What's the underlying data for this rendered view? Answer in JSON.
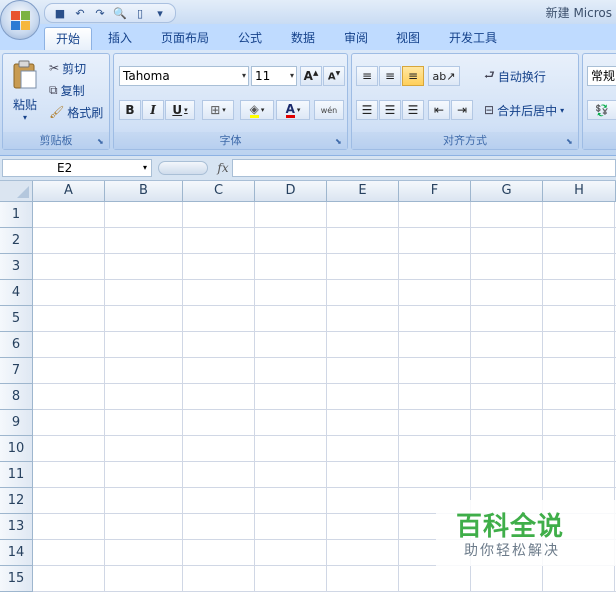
{
  "window": {
    "title": "新建 Micros"
  },
  "quick_access": [
    {
      "icon": "save-icon",
      "glyph": "■"
    },
    {
      "icon": "undo-icon",
      "glyph": "↶"
    },
    {
      "icon": "redo-icon",
      "glyph": "↷"
    },
    {
      "icon": "print-preview-icon",
      "glyph": "🔍"
    },
    {
      "icon": "new-document-icon",
      "glyph": "▯"
    },
    {
      "icon": "customize-qat-icon",
      "glyph": "▾"
    }
  ],
  "tabs": [
    "开始",
    "插入",
    "页面布局",
    "公式",
    "数据",
    "审阅",
    "视图",
    "开发工具"
  ],
  "ribbon": {
    "clipboard": {
      "label": "剪贴板",
      "paste": "粘贴",
      "cut": "剪切",
      "copy": "复制",
      "format_painter": "格式刷"
    },
    "font": {
      "label": "字体",
      "font_name": "Tahoma",
      "font_size": "11",
      "bold": "B",
      "italic": "I",
      "underline": "U",
      "font_color_glyph": "A",
      "phonetic": "wén"
    },
    "alignment": {
      "label": "对齐方式",
      "wrap_text": "自动换行",
      "merge_center": "合并后居中"
    },
    "number": {
      "format": "常规"
    }
  },
  "formula_bar": {
    "name_box": "E2",
    "fx": "fx",
    "formula": ""
  },
  "sheet": {
    "columns": [
      "A",
      "B",
      "C",
      "D",
      "E",
      "F",
      "G",
      "H"
    ],
    "rows": [
      "1",
      "2",
      "3",
      "4",
      "5",
      "6",
      "7",
      "8",
      "9",
      "10",
      "11",
      "12",
      "13",
      "14",
      "15"
    ]
  },
  "watermark": {
    "main": "百科全说",
    "sub": "助你轻松解决"
  },
  "colors": {
    "ribbon_bg": "#c7daf3",
    "tab_bar": "#bfdbff",
    "text_blue": "#15428b",
    "grid_line": "#d0d7e5",
    "watermark_green": "#3fae49"
  }
}
